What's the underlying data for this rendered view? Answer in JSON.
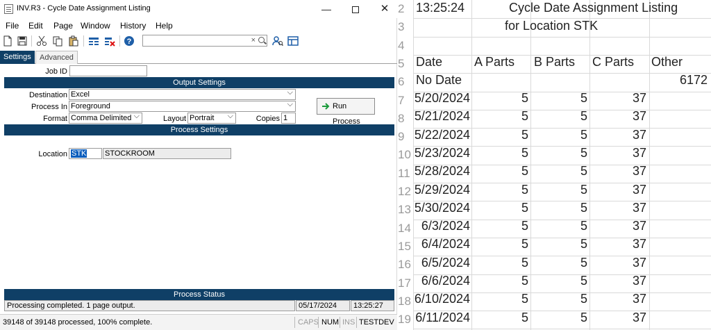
{
  "window": {
    "title": "INV.R3 - Cycle Date Assignment Listing",
    "minimize": "—",
    "close": "✕"
  },
  "menu": [
    "File",
    "Edit",
    "Page",
    "Window",
    "History",
    "Help"
  ],
  "toolbar": {
    "search_value": "",
    "search_clear": "×",
    "icons": [
      "new-icon",
      "save-icon",
      "cut-icon",
      "copy-icon",
      "paste-icon",
      "columns-icon",
      "delete-columns-icon",
      "help-icon",
      "find-user-icon",
      "layout-icon"
    ]
  },
  "tabs": [
    "Settings",
    "Advanced"
  ],
  "form": {
    "job_id_label": "Job ID",
    "job_id_value": "",
    "output_settings_title": "Output Settings",
    "destination_label": "Destination",
    "destination_value": "Excel",
    "process_in_label": "Process In",
    "process_in_value": "Foreground",
    "format_label": "Format",
    "format_value": "Comma Delimited",
    "layout_label": "Layout",
    "layout_value": "Portrait",
    "copies_label": "Copies",
    "copies_value": "1",
    "run_button": "Run Process",
    "process_settings_title": "Process Settings",
    "location_label": "Location",
    "location_code": "STK",
    "location_name": "STOCKROOM"
  },
  "status": {
    "title": "Process Status",
    "message": "Processing completed.  1 page output.",
    "date": "05/17/2024",
    "time": "13:25:27"
  },
  "bottom_bar": {
    "progress_text": "39148 of 39148 processed,  100% complete.",
    "caps": "CAPS",
    "num": "NUM",
    "ins": "INS",
    "user": "TESTDEV"
  },
  "colors": {
    "section_bar": "#0f3f66",
    "selection": "#0b5ebd"
  },
  "sheet": {
    "time": "13:25:24",
    "title_line1": "Cycle Date Assignment Listing",
    "title_line2": "for Location STK",
    "row_numbers": [
      "2",
      "3",
      "4",
      "5",
      "6",
      "7",
      "8",
      "9",
      "10",
      "11",
      "12",
      "13",
      "14",
      "15",
      "16",
      "17",
      "18",
      "19"
    ],
    "headers": [
      "Date",
      "A Parts",
      "B Parts",
      "C Parts",
      "Other"
    ],
    "no_date_label": "No Date",
    "no_date_other": "6172",
    "rows": [
      {
        "date": "5/20/2024",
        "a": "5",
        "b": "5",
        "c": "37"
      },
      {
        "date": "5/21/2024",
        "a": "5",
        "b": "5",
        "c": "37"
      },
      {
        "date": "5/22/2024",
        "a": "5",
        "b": "5",
        "c": "37"
      },
      {
        "date": "5/23/2024",
        "a": "5",
        "b": "5",
        "c": "37"
      },
      {
        "date": "5/28/2024",
        "a": "5",
        "b": "5",
        "c": "37"
      },
      {
        "date": "5/29/2024",
        "a": "5",
        "b": "5",
        "c": "37"
      },
      {
        "date": "5/30/2024",
        "a": "5",
        "b": "5",
        "c": "37"
      },
      {
        "date": "6/3/2024",
        "a": "5",
        "b": "5",
        "c": "37"
      },
      {
        "date": "6/4/2024",
        "a": "5",
        "b": "5",
        "c": "37"
      },
      {
        "date": "6/5/2024",
        "a": "5",
        "b": "5",
        "c": "37"
      },
      {
        "date": "6/6/2024",
        "a": "5",
        "b": "5",
        "c": "37"
      },
      {
        "date": "6/10/2024",
        "a": "5",
        "b": "5",
        "c": "37"
      },
      {
        "date": "6/11/2024",
        "a": "5",
        "b": "5",
        "c": "37"
      }
    ]
  }
}
